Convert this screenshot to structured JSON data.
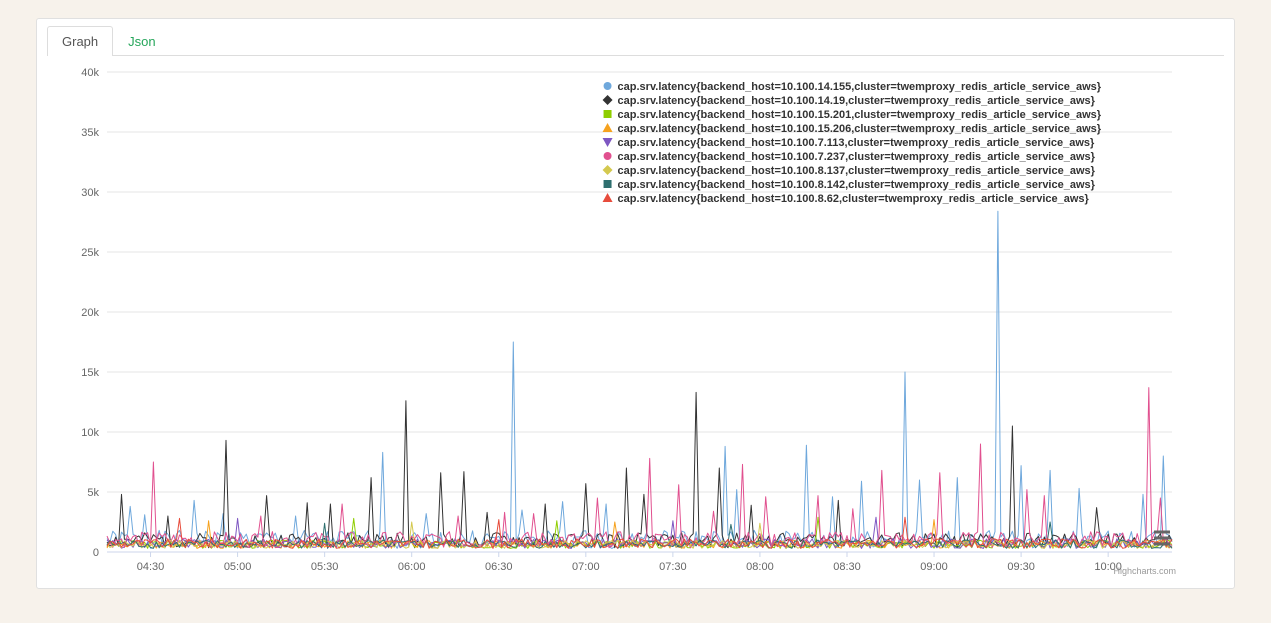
{
  "tabs": [
    {
      "label": "Graph"
    },
    {
      "label": "Json"
    }
  ],
  "credits": "Highcharts.com",
  "icons": {
    "context_menu": "chart-menu-icon"
  },
  "chart_data": {
    "type": "line",
    "title": "",
    "xlabel": "",
    "ylabel": "",
    "ylim": [
      0,
      40000
    ],
    "yticks": [
      {
        "v": 0,
        "label": "0"
      },
      {
        "v": 5000,
        "label": "5k"
      },
      {
        "v": 10000,
        "label": "10k"
      },
      {
        "v": 15000,
        "label": "15k"
      },
      {
        "v": 20000,
        "label": "20k"
      },
      {
        "v": 25000,
        "label": "25k"
      },
      {
        "v": 30000,
        "label": "30k"
      },
      {
        "v": 35000,
        "label": "35k"
      },
      {
        "v": 40000,
        "label": "40k"
      }
    ],
    "x_range_minutes": [
      255,
      622
    ],
    "xticks": [
      {
        "v": 270,
        "label": "04:30"
      },
      {
        "v": 300,
        "label": "05:00"
      },
      {
        "v": 330,
        "label": "05:30"
      },
      {
        "v": 360,
        "label": "06:00"
      },
      {
        "v": 390,
        "label": "06:30"
      },
      {
        "v": 420,
        "label": "07:00"
      },
      {
        "v": 450,
        "label": "07:30"
      },
      {
        "v": 480,
        "label": "08:00"
      },
      {
        "v": 510,
        "label": "08:30"
      },
      {
        "v": 540,
        "label": "09:00"
      },
      {
        "v": 570,
        "label": "09:30"
      },
      {
        "v": 600,
        "label": "10:00"
      }
    ],
    "series": [
      {
        "name": "cap.srv.latency{backend_host=10.100.14.155,cluster=twemproxy_redis_article_service_aws}",
        "color": "#6fa8dc",
        "noise_min": 300,
        "noise_max": 1800,
        "spikes": [
          {
            "t": 263,
            "v": 3800
          },
          {
            "t": 268,
            "v": 3100
          },
          {
            "t": 285,
            "v": 4300
          },
          {
            "t": 295,
            "v": 3200
          },
          {
            "t": 320,
            "v": 3000
          },
          {
            "t": 350,
            "v": 8300
          },
          {
            "t": 365,
            "v": 3200
          },
          {
            "t": 395,
            "v": 17500
          },
          {
            "t": 398,
            "v": 3500
          },
          {
            "t": 412,
            "v": 4200
          },
          {
            "t": 427,
            "v": 4000
          },
          {
            "t": 468,
            "v": 8800
          },
          {
            "t": 472,
            "v": 5200
          },
          {
            "t": 496,
            "v": 8900
          },
          {
            "t": 505,
            "v": 4600
          },
          {
            "t": 515,
            "v": 5900
          },
          {
            "t": 530,
            "v": 15000
          },
          {
            "t": 535,
            "v": 6000
          },
          {
            "t": 548,
            "v": 6200
          },
          {
            "t": 562,
            "v": 28400
          },
          {
            "t": 570,
            "v": 7200
          },
          {
            "t": 580,
            "v": 6800
          },
          {
            "t": 590,
            "v": 5300
          },
          {
            "t": 612,
            "v": 4800
          },
          {
            "t": 619,
            "v": 8000
          }
        ]
      },
      {
        "name": "cap.srv.latency{backend_host=10.100.14.19,cluster=twemproxy_redis_article_service_aws}",
        "color": "#333333",
        "noise_min": 350,
        "noise_max": 1600,
        "spikes": [
          {
            "t": 260,
            "v": 4800
          },
          {
            "t": 276,
            "v": 3000
          },
          {
            "t": 296,
            "v": 9300
          },
          {
            "t": 310,
            "v": 4700
          },
          {
            "t": 324,
            "v": 4100
          },
          {
            "t": 332,
            "v": 4000
          },
          {
            "t": 346,
            "v": 6200
          },
          {
            "t": 358,
            "v": 12600
          },
          {
            "t": 370,
            "v": 6600
          },
          {
            "t": 378,
            "v": 6700
          },
          {
            "t": 386,
            "v": 3300
          },
          {
            "t": 406,
            "v": 4000
          },
          {
            "t": 420,
            "v": 5700
          },
          {
            "t": 434,
            "v": 7000
          },
          {
            "t": 440,
            "v": 4800
          },
          {
            "t": 458,
            "v": 13300
          },
          {
            "t": 466,
            "v": 7000
          },
          {
            "t": 477,
            "v": 3900
          },
          {
            "t": 507,
            "v": 4300
          },
          {
            "t": 567,
            "v": 10500
          },
          {
            "t": 596,
            "v": 3700
          }
        ]
      },
      {
        "name": "cap.srv.latency{backend_host=10.100.15.201,cluster=twemproxy_redis_article_service_aws}",
        "color": "#8fce00",
        "noise_min": 300,
        "noise_max": 1000,
        "spikes": [
          {
            "t": 340,
            "v": 2800
          },
          {
            "t": 410,
            "v": 2600
          },
          {
            "t": 500,
            "v": 2900
          }
        ]
      },
      {
        "name": "cap.srv.latency{backend_host=10.100.15.206,cluster=twemproxy_redis_article_service_aws}",
        "color": "#f6a21e",
        "noise_min": 300,
        "noise_max": 1000,
        "spikes": [
          {
            "t": 290,
            "v": 2600
          },
          {
            "t": 430,
            "v": 2500
          },
          {
            "t": 540,
            "v": 2700
          }
        ]
      },
      {
        "name": "cap.srv.latency{backend_host=10.100.7.113,cluster=twemproxy_redis_article_service_aws}",
        "color": "#7e57c2",
        "noise_min": 300,
        "noise_max": 1100,
        "spikes": [
          {
            "t": 300,
            "v": 2800
          },
          {
            "t": 450,
            "v": 2600
          },
          {
            "t": 520,
            "v": 2900
          }
        ]
      },
      {
        "name": "cap.srv.latency{backend_host=10.100.7.237,cluster=twemproxy_redis_article_service_aws}",
        "color": "#e1508f",
        "noise_min": 350,
        "noise_max": 1700,
        "spikes": [
          {
            "t": 271,
            "v": 7500
          },
          {
            "t": 308,
            "v": 3000
          },
          {
            "t": 336,
            "v": 4000
          },
          {
            "t": 376,
            "v": 3000
          },
          {
            "t": 392,
            "v": 3300
          },
          {
            "t": 402,
            "v": 3200
          },
          {
            "t": 424,
            "v": 4500
          },
          {
            "t": 442,
            "v": 7800
          },
          {
            "t": 452,
            "v": 5600
          },
          {
            "t": 464,
            "v": 3400
          },
          {
            "t": 474,
            "v": 7300
          },
          {
            "t": 482,
            "v": 4600
          },
          {
            "t": 500,
            "v": 4700
          },
          {
            "t": 512,
            "v": 3600
          },
          {
            "t": 522,
            "v": 6800
          },
          {
            "t": 542,
            "v": 6600
          },
          {
            "t": 556,
            "v": 9000
          },
          {
            "t": 572,
            "v": 5200
          },
          {
            "t": 578,
            "v": 4700
          },
          {
            "t": 614,
            "v": 13700
          },
          {
            "t": 618,
            "v": 4500
          }
        ]
      },
      {
        "name": "cap.srv.latency{backend_host=10.100.8.137,cluster=twemproxy_redis_article_service_aws}",
        "color": "#d4c94f",
        "noise_min": 300,
        "noise_max": 1000,
        "spikes": [
          {
            "t": 360,
            "v": 2500
          },
          {
            "t": 480,
            "v": 2400
          }
        ]
      },
      {
        "name": "cap.srv.latency{backend_host=10.100.8.142,cluster=twemproxy_redis_article_service_aws}",
        "color": "#2e6f6f",
        "noise_min": 300,
        "noise_max": 1000,
        "spikes": [
          {
            "t": 330,
            "v": 2400
          },
          {
            "t": 470,
            "v": 2300
          },
          {
            "t": 580,
            "v": 2500
          }
        ]
      },
      {
        "name": "cap.srv.latency{backend_host=10.100.8.62,cluster=twemproxy_redis_article_service_aws}",
        "color": "#e74c3c",
        "noise_min": 300,
        "noise_max": 1100,
        "spikes": [
          {
            "t": 280,
            "v": 2800
          },
          {
            "t": 390,
            "v": 2700
          },
          {
            "t": 530,
            "v": 2900
          }
        ]
      }
    ],
    "legend_markers": [
      "circle",
      "diamond",
      "square",
      "triangle-up",
      "triangle-down",
      "circle",
      "diamond",
      "square",
      "triangle-up"
    ]
  }
}
